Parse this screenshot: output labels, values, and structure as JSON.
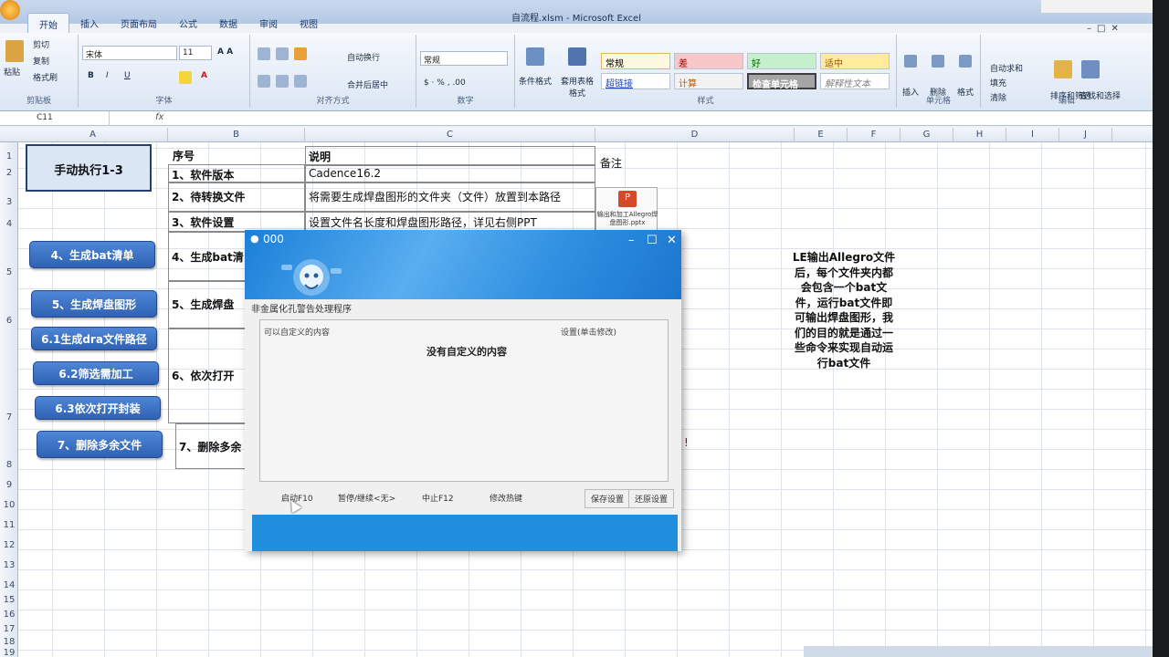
{
  "window": {
    "title": "自流程.xlsm - Microsoft Excel"
  },
  "tabs": [
    "开始",
    "插入",
    "页面布局",
    "公式",
    "数据",
    "审阅",
    "视图"
  ],
  "ribbon": {
    "clipboard": {
      "paste": "粘贴",
      "cut": "剪切",
      "copy": "复制",
      "format_painter": "格式刷",
      "label": "剪贴板"
    },
    "font": {
      "name": "宋体",
      "size": "11",
      "label": "字体"
    },
    "alignment": {
      "wrap": "自动换行",
      "merge": "合并后居中",
      "label": "对齐方式"
    },
    "number": {
      "format": "常规",
      "label": "数字"
    },
    "styles": {
      "cond_format": "条件格式",
      "table_format": "套用表格格式",
      "cells": [
        "常规",
        "差",
        "好",
        "适中",
        "超链接",
        "计算",
        "检查单元格",
        "解释性文本"
      ],
      "label": "样式"
    },
    "cells": {
      "insert": "插入",
      "delete": "删除",
      "format": "格式",
      "label": "单元格"
    },
    "editing": {
      "autosum": "自动求和",
      "fill": "填充",
      "clear": "清除",
      "sort": "排序和筛选",
      "find": "查找和选择",
      "label": "编辑"
    }
  },
  "formula_bar": {
    "cell_ref": "C11",
    "fx": "fx"
  },
  "columns": [
    "A",
    "B",
    "C",
    "D",
    "E",
    "F",
    "G",
    "H",
    "I",
    "J"
  ],
  "rows": [
    "1",
    "2",
    "3",
    "4",
    "5",
    "6",
    "7",
    "8",
    "9",
    "10",
    "11",
    "12",
    "13",
    "14",
    "15",
    "16",
    "17",
    "18",
    "19"
  ],
  "sheet": {
    "title_box": "手动执行1-3",
    "header_seq": "序号",
    "header_desc": "说明",
    "header_note": "备注",
    "steps": [
      "1、软件版本",
      "2、待转换文件",
      "3、软件设置",
      "4、生成bat清",
      "5、生成焊盘",
      "6、依次打开",
      "7、删除多余"
    ],
    "descs": [
      "Cadence16.2",
      "将需要生成焊盘图形的文件夹（文件）放置到本路径",
      "设置文件名长度和焊盘图形路径，详见右侧PPT"
    ],
    "ppt_caption": "输出和加工Allegro焊盘图形.pptx",
    "buttons": [
      "4、生成bat清单",
      "5、生成焊盘图形",
      "6.1生成dra文件路径",
      "6.2筛选需加工",
      "6.3依次打开封装",
      "7、删除多余文件"
    ],
    "note": "LE输出Allegro文件后，每个文件夹内都会包含一个bat文件，运行bat文件即可输出焊盘图形，我们的目的就是通过一些命令来实现自动运行bat文件",
    "exclaim": "!"
  },
  "dialog": {
    "title": "000",
    "subtitle": "非金属化孔警告处理程序",
    "col_custom": "可以自定义的内容",
    "col_settings": "设置(单击修改)",
    "empty": "没有自定义的内容",
    "buttons": [
      "启动F10",
      "暂停/继续<无>",
      "中止F12",
      "修改热键",
      "保存设置",
      "还原设置"
    ],
    "controls": {
      "minimize": "–",
      "maximize": "☐",
      "close": "✕"
    }
  },
  "colors": {
    "ribbon": "#dbe6f4",
    "shape_button": "#2f62b4",
    "dialog_header": "#1a7fd8"
  }
}
